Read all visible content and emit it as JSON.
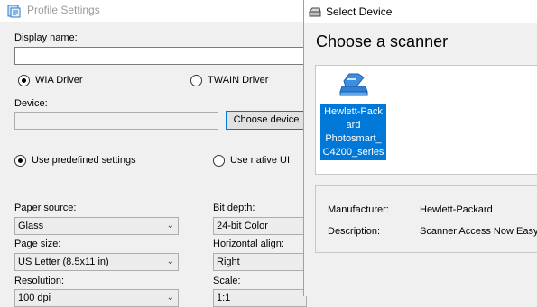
{
  "profile_window": {
    "title": "Profile Settings",
    "display_name_label": "Display name:",
    "display_name_value": "",
    "driver_options": [
      {
        "label": "WIA Driver",
        "checked": true
      },
      {
        "label": "TWAIN Driver",
        "checked": false
      }
    ],
    "device_label": "Device:",
    "device_value": "",
    "choose_device_button": "Choose device",
    "settings_options": [
      {
        "label": "Use predefined settings",
        "checked": true
      },
      {
        "label": "Use native UI",
        "checked": false
      }
    ],
    "paper_source": {
      "label": "Paper source:",
      "value": "Glass"
    },
    "bit_depth": {
      "label": "Bit depth:",
      "value": "24-bit Color"
    },
    "page_size": {
      "label": "Page size:",
      "value": "US Letter (8.5x11 in)"
    },
    "horizontal_align": {
      "label": "Horizontal align:",
      "value": "Right"
    },
    "resolution": {
      "label": "Resolution:",
      "value": "100 dpi"
    },
    "scale": {
      "label": "Scale:",
      "value": "1:1"
    }
  },
  "device_dialog": {
    "title": "Select Device",
    "heading": "Choose a scanner",
    "devices": [
      {
        "name": "Hewlett-Packard Photosmart_C4200_series",
        "lines": [
          "Hewlett-Pack",
          "ard",
          "Photosmart_",
          "C4200_series"
        ],
        "selected": true
      }
    ],
    "info": {
      "manufacturer_label": "Manufacturer:",
      "manufacturer_value": "Hewlett-Packard",
      "description_label": "Description:",
      "description_value": "Scanner Access Now Easy"
    }
  },
  "colors": {
    "accent": "#0078d7",
    "window_bg": "#f0f0f0",
    "title_inactive": "#9a9a9a"
  },
  "icons": {
    "app": "scanner-app-icon",
    "scanner": "flatbed-scanner-icon",
    "chevron": "chevron-down-icon"
  }
}
